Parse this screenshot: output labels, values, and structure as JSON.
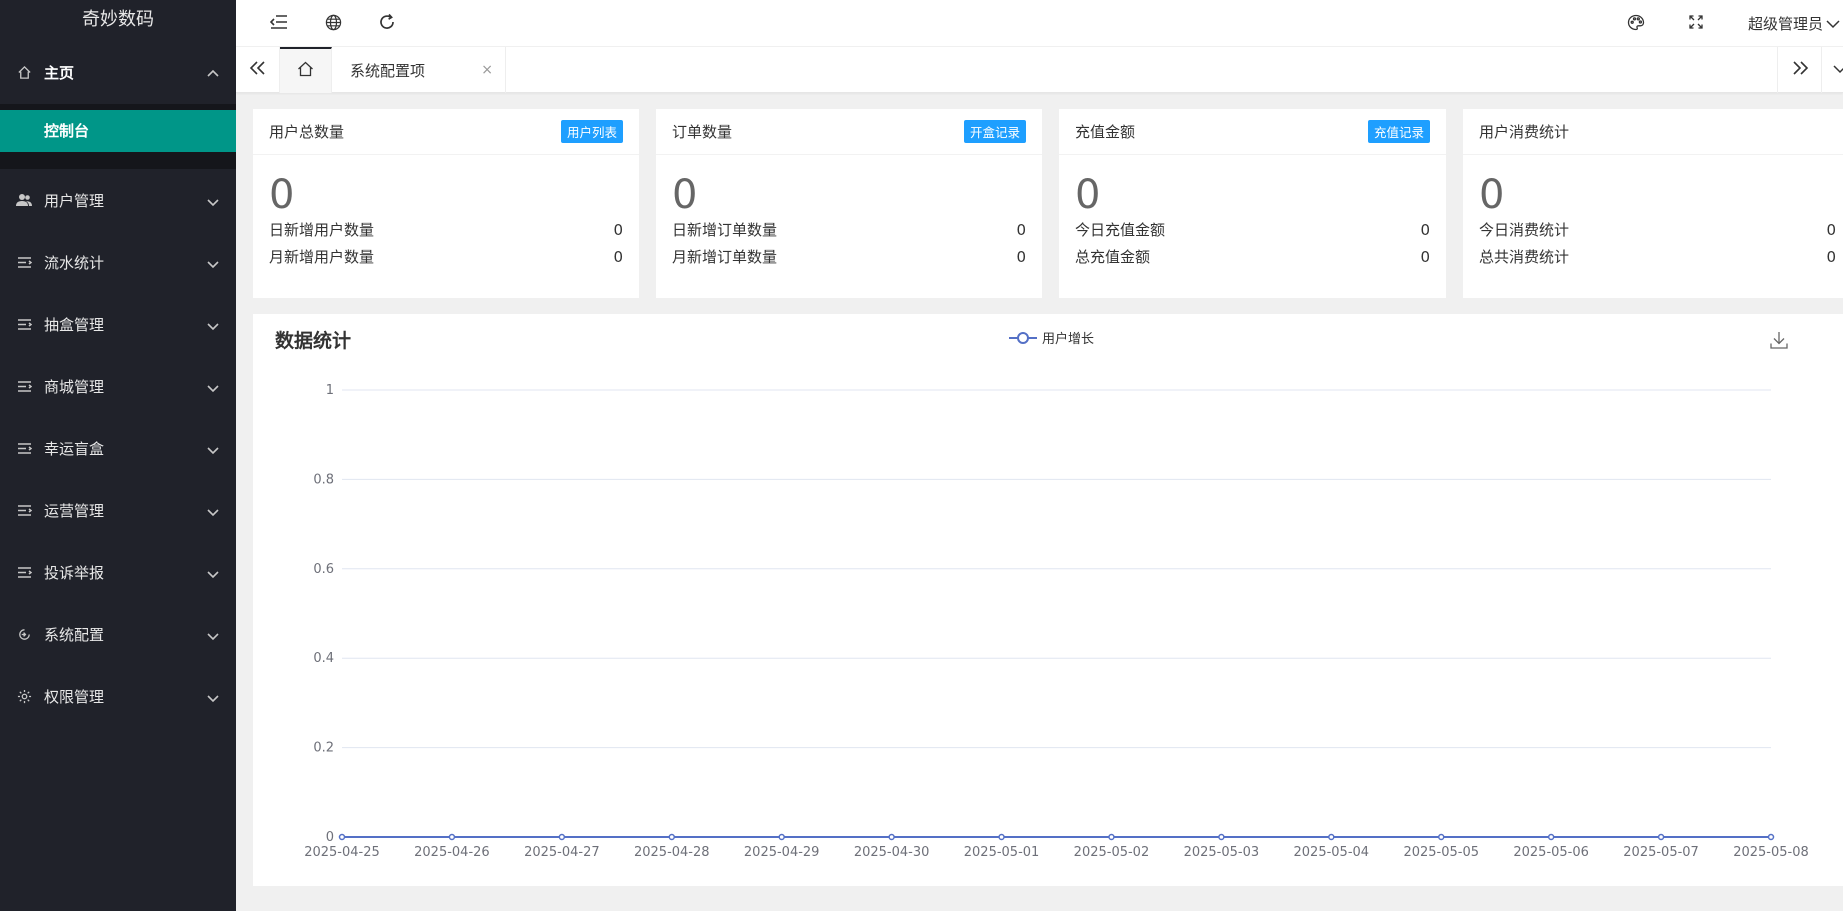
{
  "brand": "奇妙数码",
  "sidebar": {
    "home": {
      "label": "主页"
    },
    "sub_items": [
      {
        "label": "控制台"
      }
    ],
    "items": [
      {
        "label": "用户管理"
      },
      {
        "label": "流水统计"
      },
      {
        "label": "抽盒管理"
      },
      {
        "label": "商城管理"
      },
      {
        "label": "幸运盲盒"
      },
      {
        "label": "运营管理"
      },
      {
        "label": "投诉举报"
      },
      {
        "label": "系统配置"
      },
      {
        "label": "权限管理"
      }
    ]
  },
  "header": {
    "user": "超级管理员"
  },
  "tabs": [
    {
      "label": "系统配置项",
      "close": "×"
    }
  ],
  "cards": [
    {
      "title": "用户总数量",
      "badge": "用户列表",
      "value": "0",
      "rows": [
        {
          "label": "日新增用户数量",
          "value": "0"
        },
        {
          "label": "月新增用户数量",
          "value": "0"
        }
      ]
    },
    {
      "title": "订单数量",
      "badge": "开盒记录",
      "value": "0",
      "rows": [
        {
          "label": "日新增订单数量",
          "value": "0"
        },
        {
          "label": "月新增订单数量",
          "value": "0"
        }
      ]
    },
    {
      "title": "充值金额",
      "badge": "充值记录",
      "value": "0",
      "rows": [
        {
          "label": "今日充值金额",
          "value": "0"
        },
        {
          "label": "总充值金额",
          "value": "0"
        }
      ]
    },
    {
      "title": "用户消费统计",
      "badge": "",
      "value": "0",
      "rows": [
        {
          "label": "今日消费统计",
          "value": "0"
        },
        {
          "label": "总共消费统计",
          "value": "0"
        }
      ]
    }
  ],
  "colors": {
    "sidebar_bg": "#20222a",
    "active": "#009688",
    "badge": "#1e9fff",
    "series": "#5470c6"
  },
  "chart_data": {
    "type": "line",
    "title": "数据统计",
    "x": [
      "2025-04-25",
      "2025-04-26",
      "2025-04-27",
      "2025-04-28",
      "2025-04-29",
      "2025-04-30",
      "2025-05-01",
      "2025-05-02",
      "2025-05-03",
      "2025-05-04",
      "2025-05-05",
      "2025-05-06",
      "2025-05-07",
      "2025-05-08"
    ],
    "series": [
      {
        "name": "用户增长",
        "values": [
          0,
          0,
          0,
          0,
          0,
          0,
          0,
          0,
          0,
          0,
          0,
          0,
          0,
          0
        ]
      }
    ],
    "y_ticks": [
      "0",
      "0.2",
      "0.4",
      "0.6",
      "0.8",
      "1"
    ],
    "ylim": [
      0,
      1
    ],
    "grid": true,
    "legend": "top-center"
  }
}
